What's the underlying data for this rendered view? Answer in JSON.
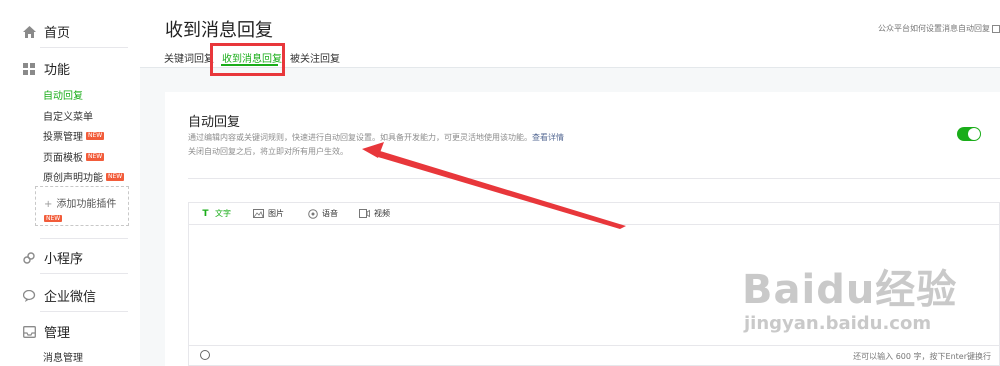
{
  "sidebar": {
    "home_label": "首页",
    "features_label": "功能",
    "feature_items": [
      {
        "label": "自动回复",
        "badge": ""
      },
      {
        "label": "自定义菜单",
        "badge": ""
      },
      {
        "label": "投票管理",
        "badge": "NEW"
      },
      {
        "label": "页面模板",
        "badge": "NEW"
      },
      {
        "label": "原创声明功能",
        "badge": "NEW"
      }
    ],
    "add_plugin_label": "添加功能插件",
    "add_plugin_badge": "NEW",
    "miniprogram_label": "小程序",
    "wework_label": "企业微信",
    "manage_label": "管理",
    "manage_items": [
      {
        "label": "消息管理"
      }
    ]
  },
  "header": {
    "title": "收到消息回复",
    "help_link": "公众平台如何设置消息自动回复",
    "tabs": [
      {
        "label": "关键词回复",
        "active": false
      },
      {
        "label": "收到消息回复",
        "active": true
      },
      {
        "label": "被关注回复",
        "active": false
      }
    ]
  },
  "card": {
    "title": "自动回复",
    "description": "通过编辑内容或关键词规则，快速进行自动回复设置。如具备开发能力，可更灵活地使用该功能。",
    "more_link": "查看详情",
    "description2": "关闭自动回复之后，将立即对所有用户生效。",
    "toggle_on": true
  },
  "editor": {
    "tabs": [
      {
        "label": "文字",
        "icon": "text-icon",
        "active": true
      },
      {
        "label": "图片",
        "icon": "image-icon",
        "active": false
      },
      {
        "label": "语音",
        "icon": "voice-icon",
        "active": false
      },
      {
        "label": "视频",
        "icon": "video-icon",
        "active": false
      }
    ],
    "counter": "还可以输入 600 字，按下Enter键换行"
  },
  "watermark": {
    "brand": "Baidu经验",
    "url": "jingyan.baidu.com"
  },
  "colors": {
    "accent": "#1aad19",
    "highlight": "#e8373b",
    "badge": "#f25c3a"
  }
}
